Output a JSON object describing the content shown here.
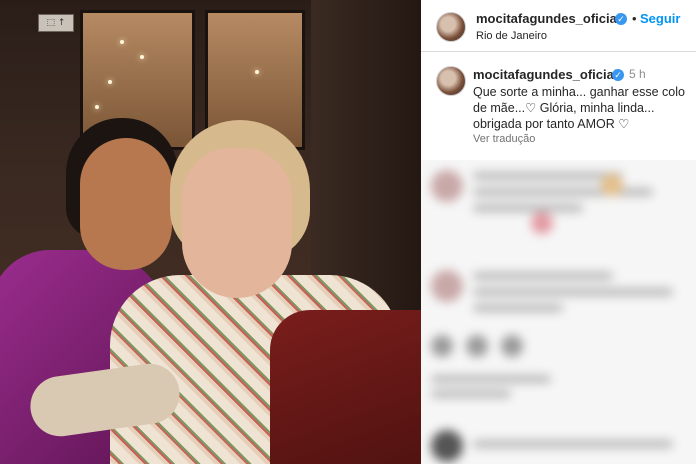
{
  "post": {
    "username": "mocitafagundes_oficial",
    "location": "Rio de Janeiro",
    "follow_label": "Seguir",
    "separator": "•",
    "verified_mark": "✓"
  },
  "caption": {
    "username": "mocitafagundes_oficial",
    "time": "5 h",
    "text": "Que sorte a minha... ganhar esse colo de mãe...♡ Glória, minha linda... obrigada por tanto AMOR ♡",
    "see_translation": "Ver tradução"
  },
  "photo": {
    "exit_sign": "⬚ ↑"
  },
  "icons": {
    "verified": "verified-badge-icon",
    "avatar": "profile-avatar"
  },
  "colors": {
    "accent": "#0095f6",
    "verified": "#3897f0",
    "text": "#262626",
    "muted": "#8e8e8e"
  }
}
